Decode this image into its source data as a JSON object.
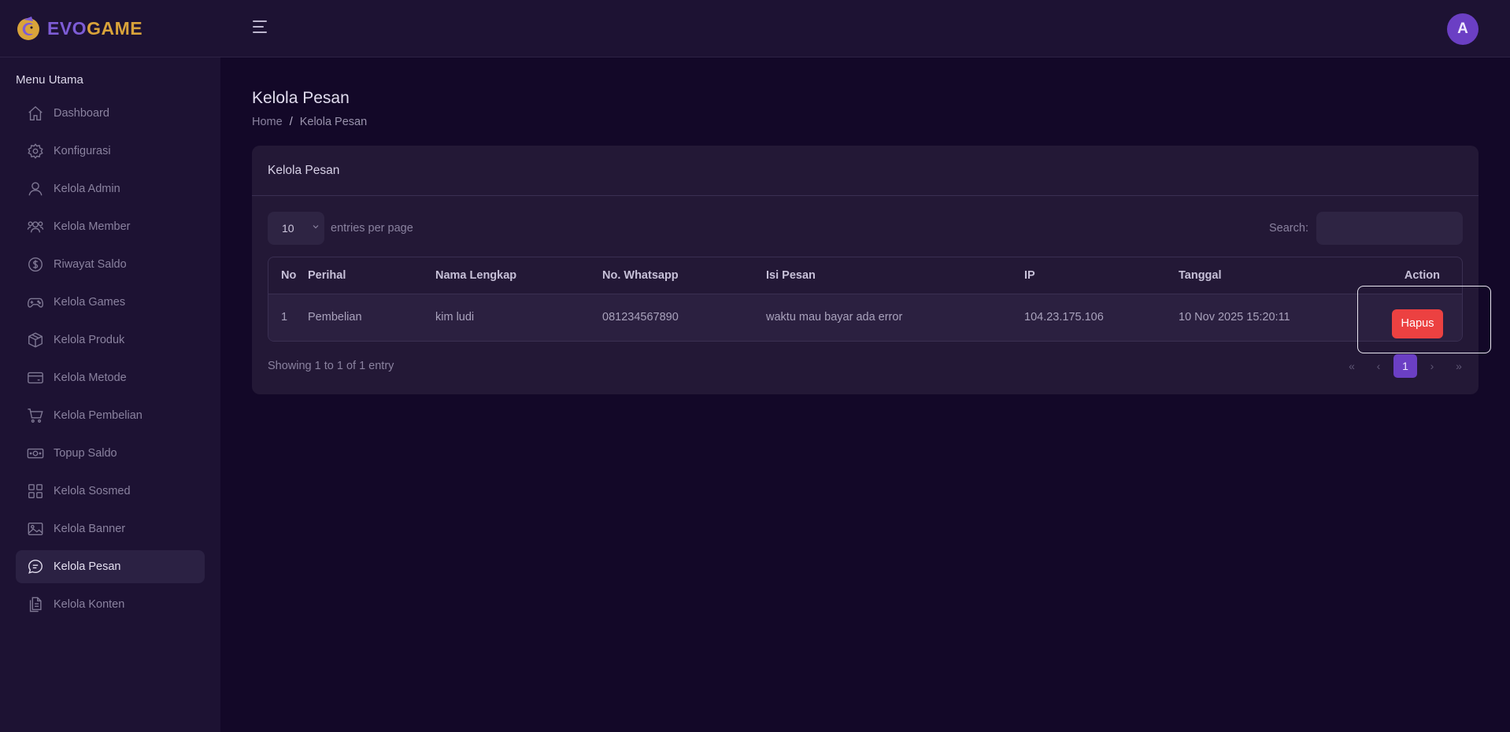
{
  "brand": {
    "part1": "EVO",
    "part2": "GAME",
    "color_evo": "#7d5cd6",
    "color_game": "#d9a33a"
  },
  "header": {
    "menu_icon": "hamburger-icon",
    "avatar_letter": "A"
  },
  "sidebar": {
    "title": "Menu Utama",
    "items": [
      {
        "label": "Dashboard",
        "icon": "home-icon"
      },
      {
        "label": "Konfigurasi",
        "icon": "gear-icon"
      },
      {
        "label": "Kelola Admin",
        "icon": "user-icon"
      },
      {
        "label": "Kelola Member",
        "icon": "users-icon"
      },
      {
        "label": "Riwayat Saldo",
        "icon": "dollar-circle-icon"
      },
      {
        "label": "Kelola Games",
        "icon": "gamepad-icon"
      },
      {
        "label": "Kelola Produk",
        "icon": "box-icon"
      },
      {
        "label": "Kelola Metode",
        "icon": "card-icon"
      },
      {
        "label": "Kelola Pembelian",
        "icon": "cart-icon"
      },
      {
        "label": "Topup Saldo",
        "icon": "money-icon"
      },
      {
        "label": "Kelola Sosmed",
        "icon": "grid-icon"
      },
      {
        "label": "Kelola Banner",
        "icon": "image-icon"
      },
      {
        "label": "Kelola Pesan",
        "icon": "message-icon",
        "active": true
      },
      {
        "label": "Kelola Konten",
        "icon": "document-icon"
      }
    ]
  },
  "page": {
    "title": "Kelola Pesan",
    "breadcrumb": {
      "home": "Home",
      "separator": "/",
      "current": "Kelola Pesan"
    }
  },
  "card": {
    "title": "Kelola Pesan",
    "entries_value": "10",
    "entries_label": "entries per page",
    "search_label": "Search:",
    "search_value": "",
    "table": {
      "columns": [
        "No",
        "Perihal",
        "Nama Lengkap",
        "No. Whatsapp",
        "Isi Pesan",
        "IP",
        "Tanggal",
        "Action"
      ],
      "rows": [
        {
          "no": "1",
          "perihal": "Pembelian",
          "nama": "kim ludi",
          "whatsapp": "081234567890",
          "isi": "waktu mau bayar ada error",
          "ip": "104.23.175.106",
          "tanggal": "10 Nov 2025 15:20:11",
          "action_label": "Hapus"
        }
      ]
    },
    "info": "Showing 1 to 1 of 1 entry",
    "pagination": {
      "first": "«",
      "prev": "‹",
      "current": "1",
      "next": "›",
      "last": "»"
    }
  },
  "colors": {
    "accent": "#6b3fc4",
    "danger": "#ec4141",
    "background": "#130828",
    "panel": "#1d1233"
  }
}
